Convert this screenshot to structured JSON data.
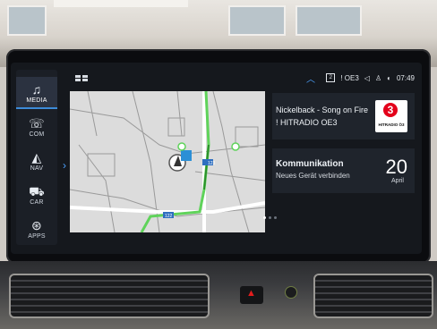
{
  "sidebar": {
    "items": [
      {
        "label": "MEDIA",
        "icon": "music-note-icon",
        "glyph": "♫"
      },
      {
        "label": "COM",
        "icon": "phone-icon",
        "glyph": "☏"
      },
      {
        "label": "NAV",
        "icon": "navigation-icon",
        "glyph": "◭"
      },
      {
        "label": "CAR",
        "icon": "car-icon",
        "glyph": "⛟"
      },
      {
        "label": "APPS",
        "icon": "apps-icon",
        "glyph": "⊛"
      }
    ],
    "active_index": 0
  },
  "status_bar": {
    "station_label": "! OE3",
    "time": "07:49",
    "icons": [
      "sim-card-icon",
      "volume-icon",
      "person-icon",
      "connection-icon"
    ]
  },
  "map": {
    "road_number_1": "123",
    "road_number_2": "122",
    "road_number_3": "123"
  },
  "media_card": {
    "line1": "Nickelback - Song on Fire",
    "line2": "! HITRADIO OE3",
    "logo_caption": "HITRADIO Ö3",
    "logo_mark": "3"
  },
  "com_card": {
    "title": "Kommunikation",
    "subtitle": "Neues Gerät verbinden",
    "day": "20",
    "month": "April"
  },
  "colors": {
    "accent": "#3d8bd8",
    "screen_bg": "#15181d",
    "card_bg": "#1f242c",
    "route_green": "#5fd35a",
    "hazard_red": "#e21d1d"
  }
}
